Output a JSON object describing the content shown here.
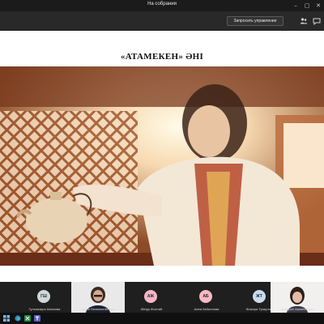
{
  "window": {
    "title": "На собрании"
  },
  "toolbar": {
    "request_control": "Запросить управление"
  },
  "slide": {
    "title": "«АТАМЕКЕН» ӘНІ"
  },
  "participants": [
    {
      "initials": "ГШ",
      "name": "Гульназира Шалкова",
      "color": "#cfd9d9"
    },
    {
      "initials": "",
      "name": "Сауле Бекмаганбетова",
      "color": ""
    },
    {
      "initials": "АЖ",
      "name": "Айнур Жолтай",
      "color": "#f2b6c6"
    },
    {
      "initials": "АБ",
      "name": "Асем Бейсенова",
      "color": "#f6b9c3"
    },
    {
      "initials": "ЖТ",
      "name": "Жазира Туякуловa",
      "color": "#c7dcef"
    },
    {
      "initials": "",
      "name": "Акмарал Амангельды",
      "color": ""
    }
  ],
  "taskbar": {
    "apps": [
      "start-icon",
      "edge-icon",
      "excel-icon",
      "teams-icon"
    ]
  }
}
